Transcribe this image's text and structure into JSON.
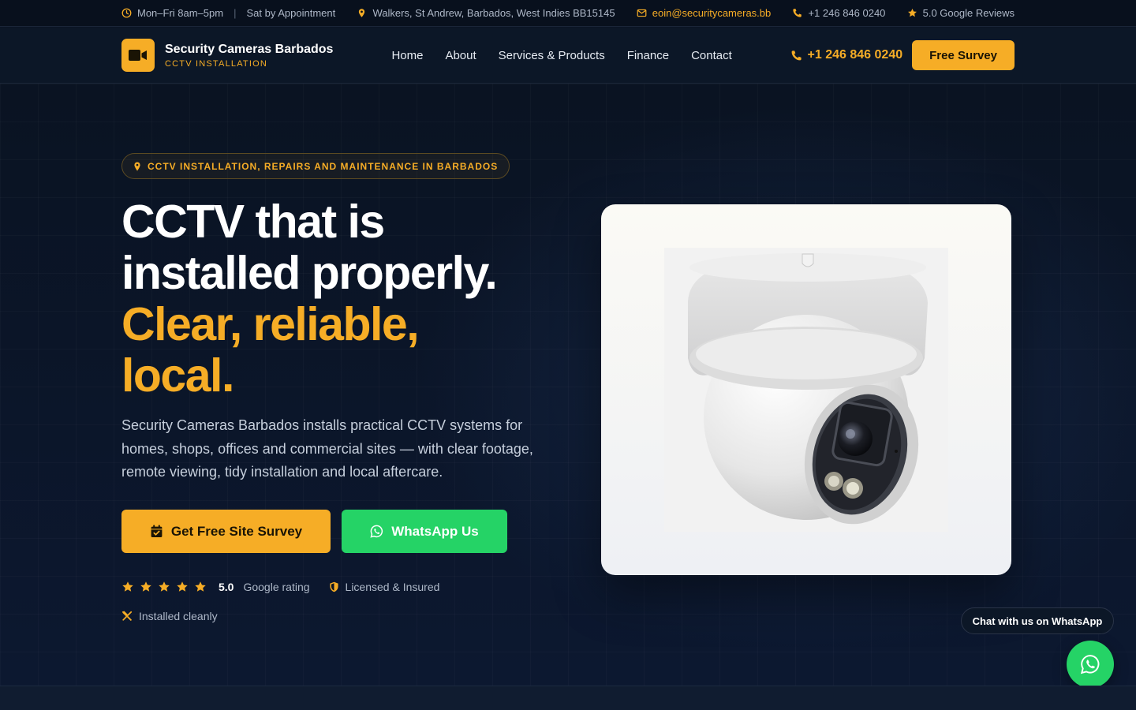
{
  "topbar": {
    "hours": "Mon–Fri 8am–5pm",
    "hours_extra": "Sat by Appointment",
    "address": "Walkers, St Andrew, Barbados, West Indies BB15145",
    "email": "eoin@securitycameras.bb",
    "phone": "+1 246 846 0240",
    "reviews": "5.0 Google Reviews"
  },
  "nav": {
    "brand_title": "Security Cameras Barbados",
    "brand_sub": "CCTV INSTALLATION",
    "menu": [
      "Home",
      "About",
      "Services & Products",
      "Finance",
      "Contact"
    ],
    "phone": "+1 246 846 0240",
    "cta": "Free Survey"
  },
  "hero": {
    "badge": "CCTV INSTALLATION, REPAIRS AND MAINTENANCE IN BARBADOS",
    "headline_white_1": "CCTV that is",
    "headline_white_2": "installed properly.",
    "headline_yellow_1": "Clear, reliable,",
    "headline_yellow_2": "local.",
    "lead": "Security Cameras Barbados installs practical CCTV systems for homes, shops, offices and commercial sites — with clear footage, remote viewing, tidy installation and local aftercare.",
    "btn_primary": "Get Free Site Survey",
    "btn_whatsapp": "WhatsApp Us",
    "rating_value": "5.0",
    "rating_label": "Google rating",
    "stars": 5,
    "licensed": "Licensed & Insured",
    "installed": "Installed cleanly"
  },
  "chat": {
    "label": "Chat with us on WhatsApp"
  },
  "colors": {
    "accent": "#f6ad26",
    "whatsapp": "#25d366",
    "background": "#0b1424"
  }
}
